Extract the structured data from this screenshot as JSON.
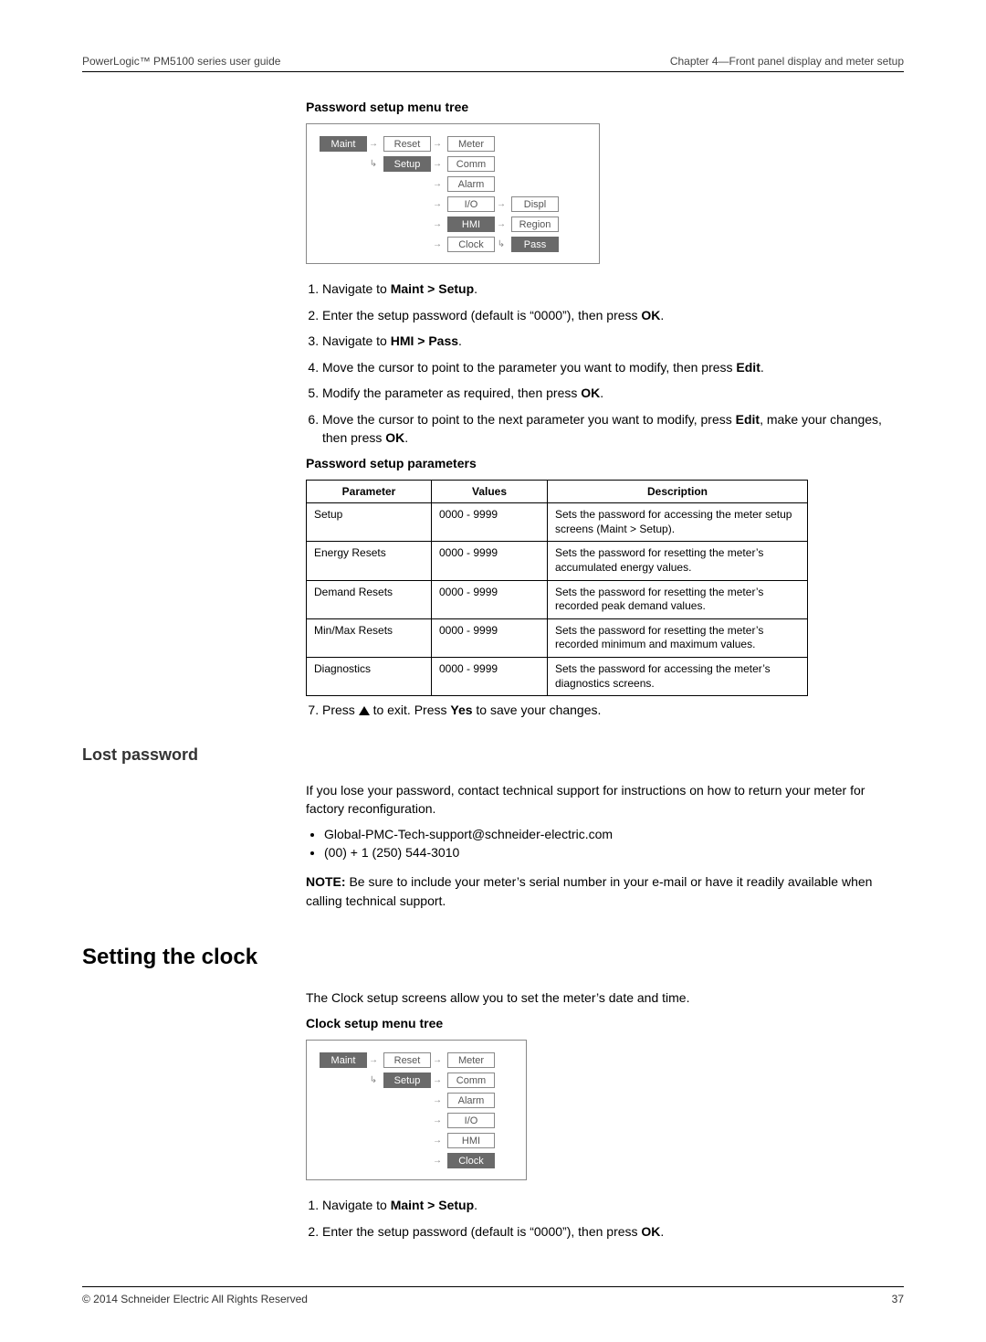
{
  "header": {
    "left": "PowerLogic™ PM5100 series user guide",
    "right": "Chapter 4—Front panel display and meter setup"
  },
  "password_setup": {
    "menu_tree_title": "Password setup menu tree",
    "tree": {
      "c1": "Maint",
      "c2a": "Reset",
      "c2b": "Setup",
      "c3": [
        "Meter",
        "Comm",
        "Alarm",
        "I/O",
        "HMI",
        "Clock"
      ],
      "c4": [
        "Displ",
        "Region",
        "Pass"
      ]
    },
    "steps_a": [
      "Navigate to <b>Maint > Setup</b>.",
      "Enter the setup password (default is “0000”), then press <b>OK</b>.",
      "Navigate to <b>HMI > Pass</b>.",
      "Move the cursor to point to the parameter you want to modify, then press <b>Edit</b>.",
      "Modify the parameter as required, then press <b>OK</b>.",
      "Move the cursor to point to the next parameter you want to modify, press <b>Edit</b>, make your changes, then press <b>OK</b>."
    ],
    "params_title": "Password setup parameters",
    "params_headers": [
      "Parameter",
      "Values",
      "Description"
    ],
    "params": [
      {
        "p": "Setup",
        "v": "0000 - 9999",
        "d": "Sets the password for accessing the meter setup screens (Maint > Setup)."
      },
      {
        "p": "Energy Resets",
        "v": "0000 - 9999",
        "d": "Sets the password for resetting the meter’s accumulated energy values."
      },
      {
        "p": "Demand Resets",
        "v": "0000 - 9999",
        "d": "Sets the password for resetting the meter’s recorded peak demand values."
      },
      {
        "p": "Min/Max Resets",
        "v": "0000 - 9999",
        "d": "Sets the password for resetting the meter’s recorded minimum and maximum values."
      },
      {
        "p": "Diagnostics",
        "v": "0000 - 9999",
        "d": "Sets the password for accessing the meter’s diagnostics screens."
      }
    ],
    "step7_pre": "Press ",
    "step7_post": " to exit. Press <b>Yes</b> to save your changes."
  },
  "lost_password": {
    "heading": "Lost password",
    "body": "If you lose your password, contact technical support for instructions on how to return your meter for factory reconfiguration.",
    "bullets": [
      "Global-PMC-Tech-support@schneider-electric.com",
      "(00) + 1 (250) 544-3010"
    ],
    "note": "<b>NOTE:</b> Be sure to include your meter’s serial number in your e-mail or have it readily available when calling technical support."
  },
  "setting_clock": {
    "heading": "Setting the clock",
    "intro": "The Clock setup screens allow you to set the meter’s date and time.",
    "menu_tree_title": "Clock setup menu tree",
    "tree": {
      "c1": "Maint",
      "c2a": "Reset",
      "c2b": "Setup",
      "c3": [
        "Meter",
        "Comm",
        "Alarm",
        "I/O",
        "HMI",
        "Clock"
      ]
    },
    "steps": [
      "Navigate to <b>Maint > Setup</b>.",
      "Enter the setup password (default is “0000”), then press <b>OK</b>."
    ]
  },
  "footer": {
    "left": "© 2014 Schneider Electric All Rights Reserved",
    "right": "37"
  }
}
